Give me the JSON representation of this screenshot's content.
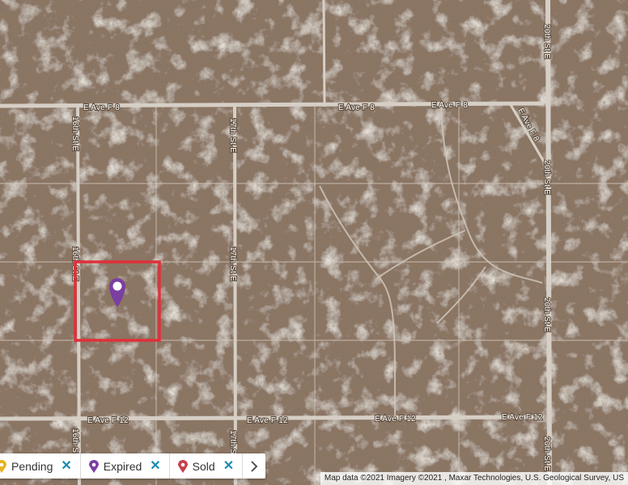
{
  "map": {
    "roads": {
      "ave_f8": "E Ave F 8",
      "ave_f12": "E Ave F 12",
      "st16": "16th St E",
      "st17": "17th St E",
      "st20": "20th St E"
    },
    "attribution": "Map data ©2021 Imagery ©2021 , Maxar Technologies, U.S. Geological Survey, US",
    "selection_color": "#e0303a",
    "marker_color": "#7a3fa0"
  },
  "legend": {
    "items": [
      {
        "label": "Pending",
        "color": "#e8b21e",
        "remove_color": "#1a8bb0"
      },
      {
        "label": "Expired",
        "color": "#7a3fa0",
        "remove_color": "#1a8bb0"
      },
      {
        "label": "Sold",
        "color": "#c8404a",
        "remove_color": "#1a8bb0"
      }
    ],
    "next_icon": "chevron-right-icon"
  }
}
